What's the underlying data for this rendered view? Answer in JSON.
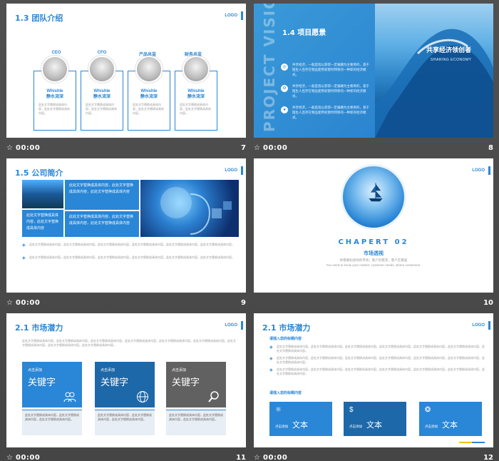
{
  "logo": "LOGO",
  "footer_star": "☆",
  "slides": [
    {
      "number": "7",
      "time": "00:00",
      "title": "1.3 团队介绍",
      "roles": [
        "CEO",
        "CFO",
        "产品总监",
        "财务总监"
      ],
      "members": [
        {
          "name": "Whishle",
          "alias": "静水流深",
          "desc": "此处文字替换成具体内容，此处文字替换成具体内容。"
        },
        {
          "name": "Whishle",
          "alias": "静水流深",
          "desc": "此处文字替换成具体内容，此处文字替换成具体内容。"
        },
        {
          "name": "Whishle",
          "alias": "静水流深",
          "desc": "此处文字替换成具体内容，此处文字替换成具体内容。"
        },
        {
          "name": "Whishle",
          "alias": "静水流深",
          "desc": "此处文字替换成具体内容，此处文字替换成具体内容。"
        }
      ]
    },
    {
      "number": "8",
      "time": "00:00",
      "title": "1.4 项目愿景",
      "vertical": "PROJECT VISION",
      "share_cn": "共享经济领创者",
      "share_en": "SHARING ECONOMY",
      "rows": [
        {
          "icon": "◎",
          "text": "共享经济，一般是指以获得一定报酬为主要目的，基于陌生人且存在物品使用权暂时转移的一种新的经济模式。"
        },
        {
          "icon": "⚙",
          "text": "共享经济，一般是指以获得一定报酬为主要目的，基于陌生人且存在物品使用权暂时转移的一种新的经济模式。"
        },
        {
          "icon": "●",
          "text": "共享经济，一般是指以获得一定报酬为主要目的，基于陌生人且存在物品使用权暂时转移的一种新的经济模式。"
        }
      ]
    },
    {
      "number": "9",
      "time": "00:00",
      "title": "1.5 公司简介",
      "box_top": "此处文字替换成具体内容，此处文字替换成具体内容，此处文字替换成具体内容",
      "box_left": "此处文字替换成具体内容，此处文字替换成具体内容",
      "box_bottom": "此处文字替换成具体内容，此处文字替换成具体内容，此处文字替换成具体内容",
      "bullets": [
        "此处文字替换成具体内容。此处文字替换成具体内容。此处文字替换成具体内容。此处文字替换成具体内容。此处文字替换成具体内容。此处文字替换成具体内容。",
        "此处文字替换成具体内容。此处文字替换成具体内容。此处文字替换成具体内容。此处文字替换成具体内容。此处文字替换成具体内容。此处文字替换成具体内容。"
      ]
    },
    {
      "number": "10",
      "time": "",
      "chapter": "CHAPERT 02",
      "chapter_cn": "市场透视",
      "sub_cn": "你需要知道你的市场，客户的需求，客户在哪里",
      "sub_en": "You need to know your market, customer needs, where customers."
    },
    {
      "number": "11",
      "time": "00:00",
      "title": "2.1 市场潜力",
      "desc": "此处文字替换成具体内容。此处文字替换成具体内容。此处文字替换成具体内容。此处文字替换成具体内容。此处文字替换成具体内容。此处文字替换成具体内容。此处文字替换成具体内容。此处文字替换成具体内容。此处文字替换成具体内容。",
      "boxes": [
        {
          "small": "点击添加",
          "big": "关键字",
          "color": "#2a86d6",
          "icon": "users-icon",
          "desc": "此处文字替换成具体内容，此处文字替换成具体内容，此处文字替换成具体内容。"
        },
        {
          "small": "点击添加",
          "big": "关键字",
          "color": "#1d68a8",
          "icon": "globe-icon",
          "desc": "此处文字替换成具体内容，此处文字替换成具体内容，此处文字替换成具体内容。"
        },
        {
          "small": "点击添加",
          "big": "关键字",
          "color": "#616161",
          "icon": "search-icon",
          "desc": "此处文字替换成具体内容，此处文字替换成具体内容，此处文字替换成具体内容。"
        }
      ]
    },
    {
      "number": "12",
      "time": "00:00",
      "title": "2.1 市场潜力",
      "heading1": "请插入您的标题内容",
      "rows": [
        "此处文字替换成具体内容。此处文字替换成具体内容。此处文字替换成具体内容。此处文字替换成具体内容。此处文字替换成具体内容。此处文字替换成具体内容。此处文字替换成具体内容。",
        "此处文字替换成具体内容。此处文字替换成具体内容。此处文字替换成具体内容。此处文字替换成具体内容。此处文字替换成具体内容。此处文字替换成具体内容。此处文字替换成具体内容。",
        "此处文字替换成具体内容。此处文字替换成具体内容。此处文字替换成具体内容。此处文字替换成具体内容。此处文字替换成具体内容。此处文字替换成具体内容。此处文字替换成具体内容。"
      ],
      "heading2": "请插入您的标题内容",
      "boxes": [
        {
          "icon": "⚛",
          "label": "点击添加",
          "main": "文本",
          "color": "#2a86d6"
        },
        {
          "icon": "$",
          "label": "点击添加",
          "main": "文本",
          "color": "#1d68a8"
        },
        {
          "icon": "❂",
          "label": "点击添加",
          "main": "文本",
          "color": "#2a86d6"
        }
      ]
    }
  ]
}
